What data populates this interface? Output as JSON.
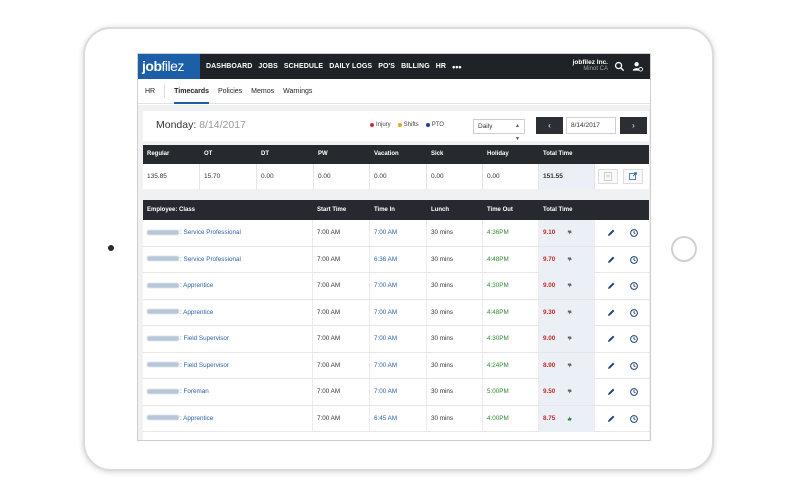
{
  "nav": {
    "logo_bold": "job",
    "logo_rest": "filez",
    "items": [
      "DASHBOARD",
      "JOBS",
      "SCHEDULE",
      "DAILY LOGS",
      "PO'S",
      "BILLING",
      "HR",
      "•••"
    ],
    "company_name": "jobfilez Inc.",
    "company_location": "Minot CA",
    "icons": [
      "search-icon",
      "user-settings-icon"
    ]
  },
  "subnav": {
    "items": [
      "HR",
      "Timecards",
      "Policies",
      "Memos",
      "Warnings"
    ],
    "active": "Timecards"
  },
  "date_bar": {
    "day": "Monday:",
    "date": "8/14/2017",
    "legend": [
      {
        "label": "Injury",
        "color": "#d32f2f"
      },
      {
        "label": "Shifts",
        "color": "#f0a020"
      },
      {
        "label": "PTO",
        "color": "#1a3fa8"
      }
    ],
    "view_select": "Daily",
    "prev": "‹",
    "next": "›",
    "date_input": "8/14/2017"
  },
  "summary": {
    "headers": [
      "Regular",
      "OT",
      "DT",
      "PW",
      "Vacation",
      "Sick",
      "Holiday",
      "Total Time"
    ],
    "values": [
      "135.85",
      "15.70",
      "0.00",
      "0.00",
      "0.00",
      "0.00",
      "0.00",
      "151.55"
    ]
  },
  "employees": {
    "headers": [
      "Employee: Class",
      "Start Time",
      "Time In",
      "Lunch",
      "Time Out",
      "Total Time"
    ],
    "rows": [
      {
        "class": ": Service Professional",
        "start": "7:00 AM",
        "in": "7:00 AM",
        "lunch": "30 mins",
        "out": "4:36PM",
        "total": "9.10",
        "flag": "thumb-down"
      },
      {
        "class": ": Service Professional",
        "start": "7:00 AM",
        "in": "6:36 AM",
        "lunch": "30 mins",
        "out": "4:48PM",
        "total": "9.70",
        "flag": "thumb-down"
      },
      {
        "class": ": Apprentice",
        "start": "7:00 AM",
        "in": "7:00 AM",
        "lunch": "30 mins",
        "out": "4:30PM",
        "total": "9.00",
        "flag": "thumb-down"
      },
      {
        "class": ": Apprentice",
        "start": "7:00 AM",
        "in": "7:00 AM",
        "lunch": "30 mins",
        "out": "4:48PM",
        "total": "9.30",
        "flag": "thumb-down"
      },
      {
        "class": ": Field Supervisor",
        "start": "7:00 AM",
        "in": "7:00 AM",
        "lunch": "30 mins",
        "out": "4:30PM",
        "total": "9.00",
        "flag": "thumb-down"
      },
      {
        "class": ": Field Supervisor",
        "start": "7:00 AM",
        "in": "7:00 AM",
        "lunch": "30 mins",
        "out": "4:24PM",
        "total": "8.90",
        "flag": "thumb-down"
      },
      {
        "class": ": Foreman",
        "start": "7:00 AM",
        "in": "7:00 AM",
        "lunch": "30 mins",
        "out": "5:00PM",
        "total": "9.50",
        "flag": "thumb-down"
      },
      {
        "class": ": Apprentice",
        "start": "7:00 AM",
        "in": "6:45 AM",
        "lunch": "30 mins",
        "out": "4:00PM",
        "total": "8.75",
        "flag": "thumb-up"
      }
    ]
  },
  "colors": {
    "brand": "#1d5ea8",
    "header_dark": "#26292d",
    "total_red": "#c62828",
    "time_out_green": "#2e8b2e",
    "link_blue": "#2a62a8"
  }
}
